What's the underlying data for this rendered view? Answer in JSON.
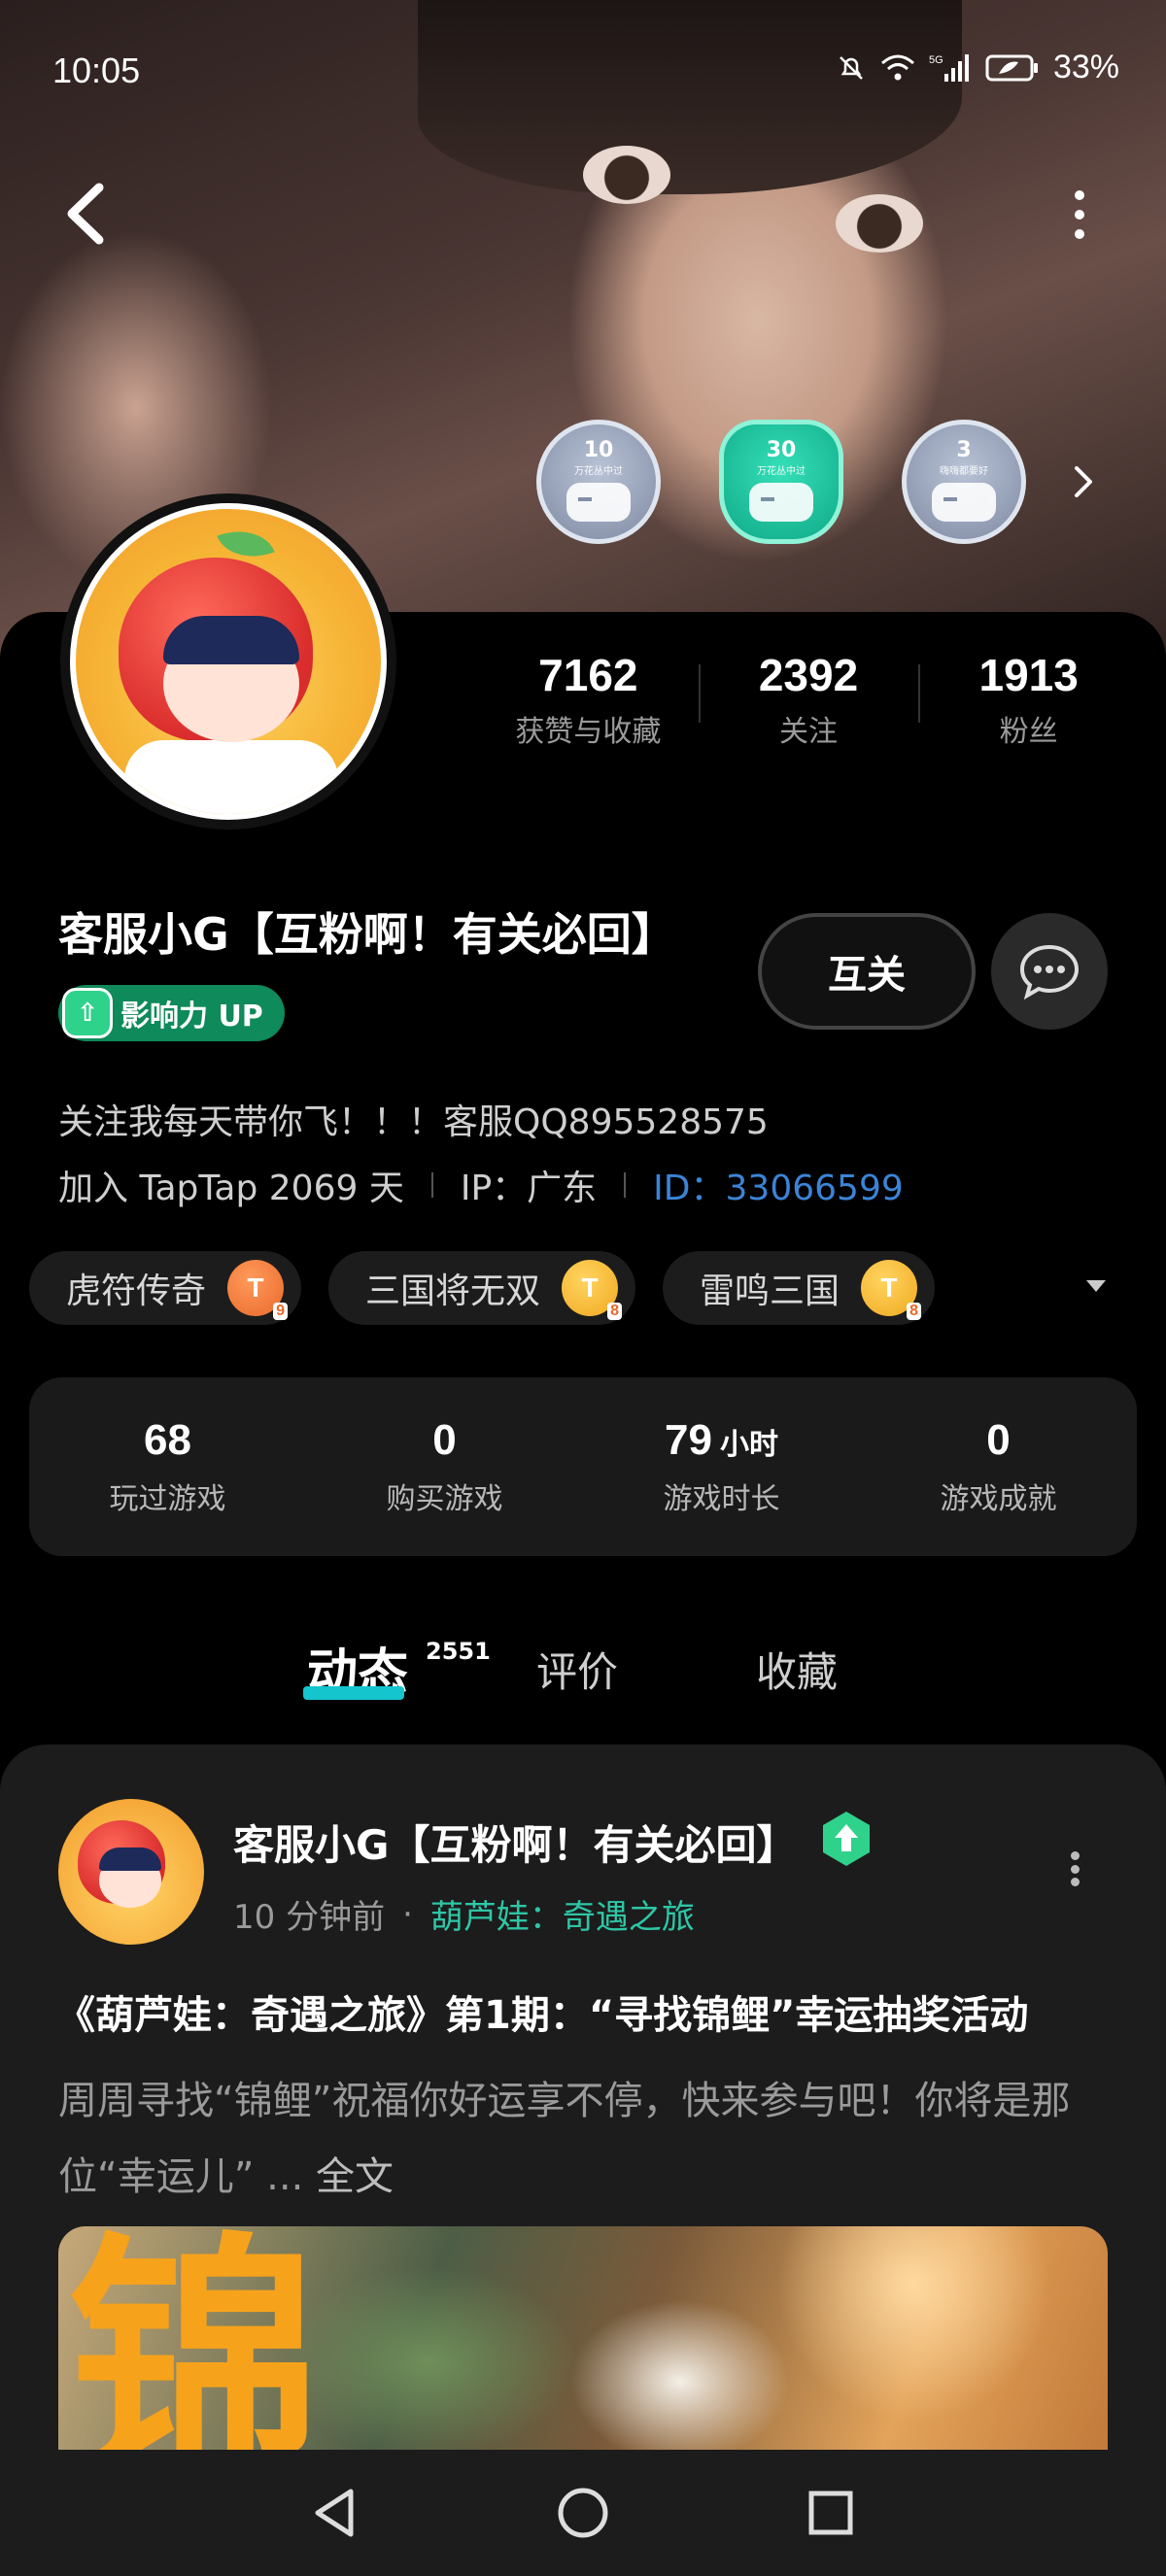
{
  "status_bar": {
    "time": "10:05",
    "battery": "33%",
    "icons": [
      "mute-bell-icon",
      "wifi-icon",
      "5g-signal-icon",
      "battery-icon"
    ]
  },
  "header": {
    "back_icon": "chevron-left-icon",
    "more_icon": "more-vertical-icon",
    "badges": [
      {
        "number": "10",
        "caption": "万花丛中过",
        "style": "silver"
      },
      {
        "number": "30",
        "caption": "万花丛中过",
        "style": "green"
      },
      {
        "number": "3",
        "caption": "嗨嗨都要好",
        "style": "silver"
      }
    ]
  },
  "profile": {
    "stats": [
      {
        "value": "7162",
        "label": "获赞与收藏"
      },
      {
        "value": "2392",
        "label": "关注"
      },
      {
        "value": "1913",
        "label": "粉丝"
      }
    ],
    "name": "客服小G【互粉啊！有关必回】",
    "influence_label": "影响力 UP",
    "mutual_button": "互关",
    "bio": "关注我每天带你飞！！！客服QQ895528575",
    "joined": "加入 TapTap 2069 天",
    "ip": "IP：广东",
    "id_label": "ID：",
    "id_value": "33066599",
    "games": [
      {
        "name": "虎符传奇",
        "level": "9",
        "color": "orange"
      },
      {
        "name": "三国将无双",
        "level": "8",
        "color": "gold"
      },
      {
        "name": "雷鸣三国",
        "level": "8",
        "color": "gold"
      }
    ],
    "play_stats": [
      {
        "value": "68",
        "unit": "",
        "label": "玩过游戏"
      },
      {
        "value": "0",
        "unit": "",
        "label": "购买游戏"
      },
      {
        "value": "79",
        "unit": "小时",
        "label": "游戏时长"
      },
      {
        "value": "0",
        "unit": "",
        "label": "游戏成就"
      }
    ]
  },
  "tabs": {
    "items": [
      "动态",
      "评价",
      "收藏"
    ],
    "active": "动态",
    "count": "2551"
  },
  "post": {
    "author": "客服小G【互粉啊！有关必回】",
    "time": "10 分钟前",
    "dot": "·",
    "game": "葫芦娃：奇遇之旅",
    "title": "《葫芦娃：奇遇之旅》第1期：“寻找锦鲤”幸运抽奖活动",
    "body": "周周寻找“锦鲤”祝福你好运享不停，快来参与吧！你将是那位“幸运儿” ...",
    "full_text": "全文",
    "image_char": "锦"
  },
  "colors": {
    "accent": "#15c5ce",
    "link_blue": "#3b84d6",
    "game_green": "#2ec6a6",
    "influence_green": "#0f8a5a"
  }
}
